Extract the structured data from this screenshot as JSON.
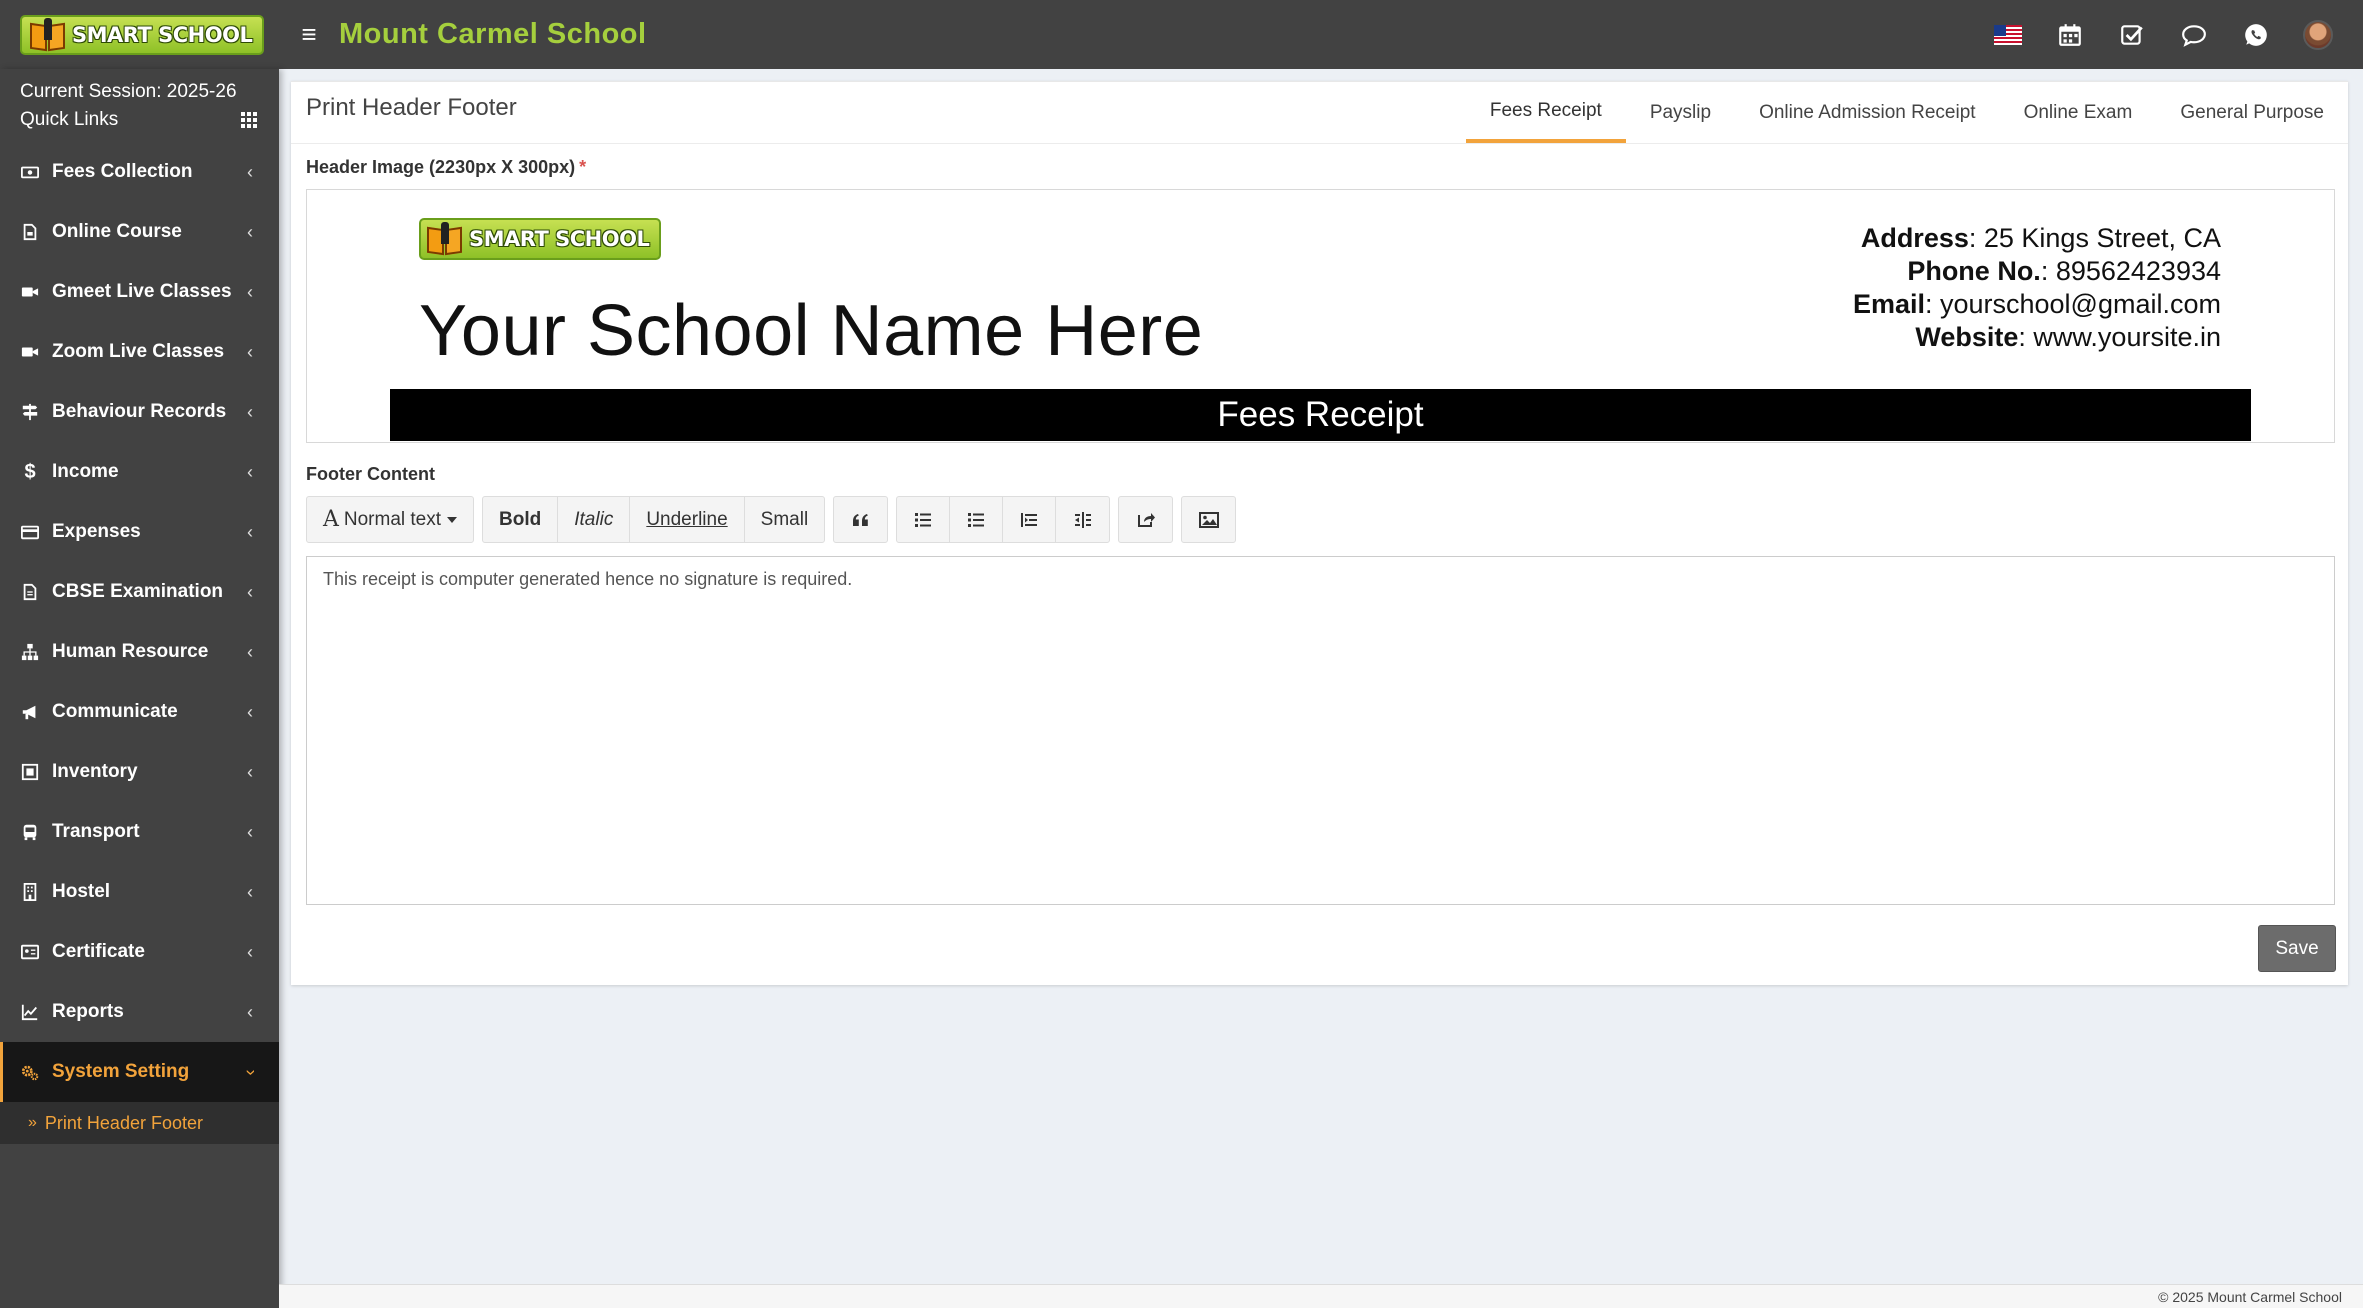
{
  "app": {
    "logo_text": "SMART SCHOOL",
    "school_name": "Mount Carmel School"
  },
  "topbar": {
    "icons": [
      "us-flag-icon",
      "calendar-icon",
      "checkbox-icon",
      "chat-bubble-icon",
      "whatsapp-icon",
      "user-avatar"
    ]
  },
  "sidebar": {
    "session": "Current Session: 2025-26",
    "quick_links": "Quick Links",
    "items": [
      {
        "label": "Fees Collection",
        "icon": "money-icon"
      },
      {
        "label": "Online Course",
        "icon": "document-icon"
      },
      {
        "label": "Gmeet Live Classes",
        "icon": "video-icon"
      },
      {
        "label": "Zoom Live Classes",
        "icon": "video-icon"
      },
      {
        "label": "Behaviour Records",
        "icon": "signpost-icon"
      },
      {
        "label": "Income",
        "icon": "dollar-icon"
      },
      {
        "label": "Expenses",
        "icon": "credit-card-icon"
      },
      {
        "label": "CBSE Examination",
        "icon": "file-icon"
      },
      {
        "label": "Human Resource",
        "icon": "sitemap-icon"
      },
      {
        "label": "Communicate",
        "icon": "bullhorn-icon"
      },
      {
        "label": "Inventory",
        "icon": "inventory-icon"
      },
      {
        "label": "Transport",
        "icon": "bus-icon"
      },
      {
        "label": "Hostel",
        "icon": "building-icon"
      },
      {
        "label": "Certificate",
        "icon": "certificate-icon"
      },
      {
        "label": "Reports",
        "icon": "line-chart-icon"
      },
      {
        "label": "System Setting",
        "icon": "gears-icon",
        "active": true
      }
    ],
    "sub_item": "Print Header Footer"
  },
  "page": {
    "title": "Print Header Footer",
    "tabs": [
      "Fees Receipt",
      "Payslip",
      "Online Admission Receipt",
      "Online Exam",
      "General Purpose"
    ],
    "active_tab": "Fees Receipt",
    "header_image_label": "Header Image (2230px X 300px)",
    "required_mark": "*",
    "header_preview": {
      "logo_text": "SMART SCHOOL",
      "school_name": "Your School Name Here",
      "address_label": "Address",
      "address_value": ": 25 Kings Street, CA",
      "phone_label": "Phone No.",
      "phone_value": ": 89562423934",
      "email_label": "Email",
      "email_value": ": yourschool@gmail.com",
      "website_label": "Website",
      "website_value": ": www.yoursite.in",
      "band_text": "Fees Receipt"
    },
    "footer_label": "Footer Content",
    "toolbar": {
      "normal_text": "Normal text",
      "bold": "Bold",
      "italic": "Italic",
      "underline": "Underline",
      "small": "Small"
    },
    "footer_text": "This receipt is computer generated hence no signature is required.",
    "save_label": "Save"
  },
  "footer": {
    "copyright": "© 2025 Mount Carmel School"
  },
  "colors": {
    "accent": "#f2a33b",
    "brand_green": "#a5cf3d",
    "topbar": "#424242",
    "band": "#000000"
  }
}
